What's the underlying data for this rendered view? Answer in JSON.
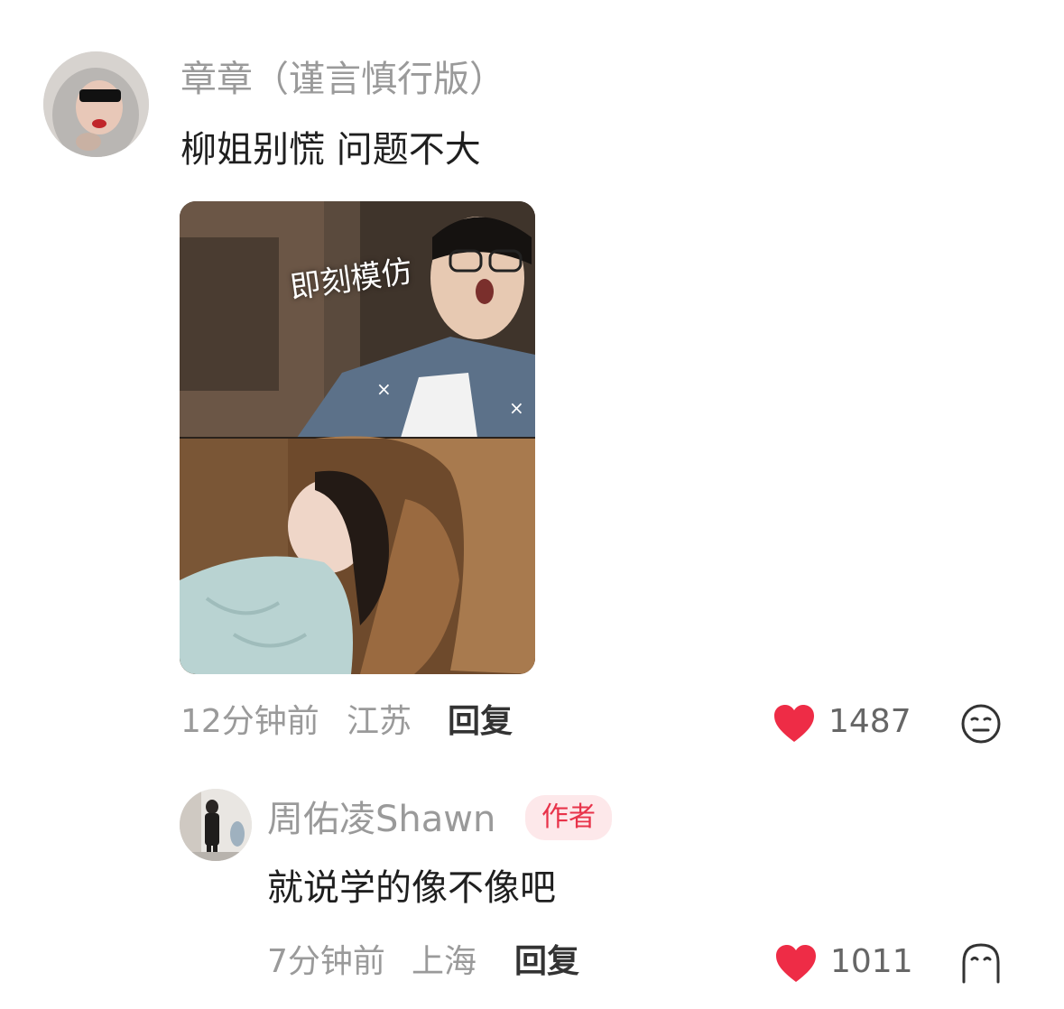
{
  "comments": [
    {
      "username": "章章（谨言慎行版）",
      "text": "柳姐别慌 问题不大",
      "image_overlay_text": "即刻模仿",
      "time": "12分钟前",
      "location": "江苏",
      "reply_label": "回复",
      "likes": "1487",
      "reaction_icon": "neutral-face-icon"
    },
    {
      "username": "周佑凌Shawn",
      "badge": "作者",
      "text": "就说学的像不像吧",
      "time": "7分钟前",
      "location": "上海",
      "reply_label": "回复",
      "likes": "1011",
      "reaction_icon": "ghost-face-icon"
    }
  ],
  "colors": {
    "like_red": "#ee2c46",
    "badge_bg": "#fde8ea",
    "badge_text": "#e8334a",
    "muted_text": "#9a9a9a"
  }
}
